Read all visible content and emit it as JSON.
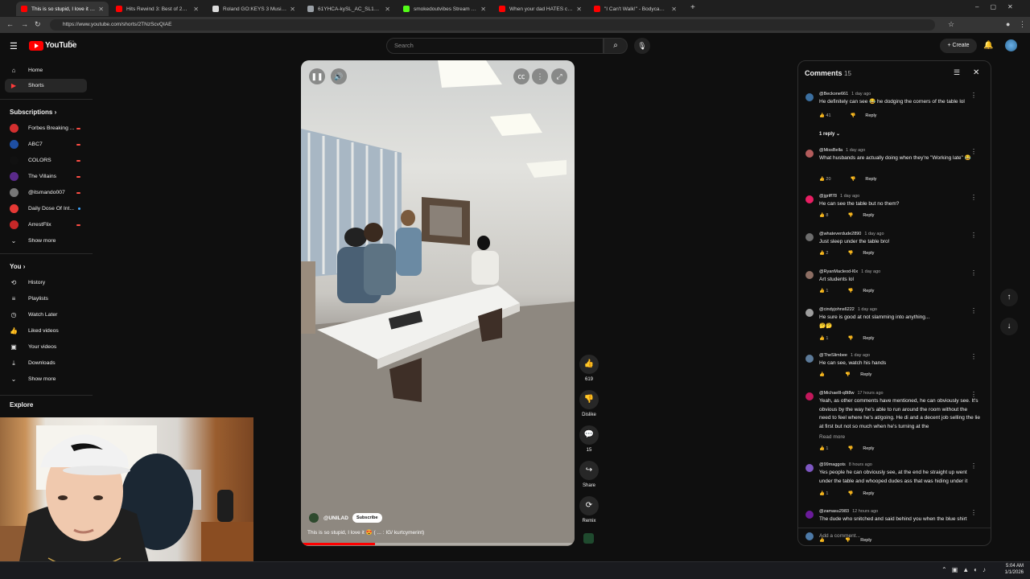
{
  "browser": {
    "tabs": [
      {
        "title": "This is so stupid, I love it 😍 #",
        "favicon_color": "#ff0000",
        "active": true
      },
      {
        "title": "Hits Rewind 3: Best of 2010's H",
        "favicon_color": "#ff0000",
        "active": false
      },
      {
        "title": "Roland GO:KEYS 3 Music Creati",
        "favicon_color": "#dcdcdc",
        "active": false
      },
      {
        "title": "61YHCA-kySL_AC_SL1500_.jpg",
        "favicon_color": "#9aa0a6",
        "active": false
      },
      {
        "title": "smokedoutvibes Stream - Watc",
        "favicon_color": "#53fc18",
        "active": false
      },
      {
        "title": "When your dad HATES cats 😂🐱",
        "favicon_color": "#ff0000",
        "active": false
      },
      {
        "title": "\"I Can't Walk!\" - Bodycam Prov",
        "favicon_color": "#ff0000",
        "active": false
      }
    ],
    "url": "https://www.youtube.com/shorts/2TNzScvQIAE",
    "new_tab": "+"
  },
  "header": {
    "logo_text": "YouTube",
    "country": "CA",
    "search_placeholder": "Search",
    "create_label": "Create"
  },
  "sidebar": {
    "home": "Home",
    "shorts": "Shorts",
    "subscriptions_heading": "Subscriptions",
    "subscriptions": [
      {
        "name": "Forbes Breaking ...",
        "color": "#d32f2f",
        "live": true
      },
      {
        "name": "ABC7",
        "color": "#1e4fa3",
        "live": true
      },
      {
        "name": "COLORS",
        "color": "#111111",
        "live": true
      },
      {
        "name": "The Villains",
        "color": "#5a2a8a",
        "live": true
      },
      {
        "name": "@itsmando007",
        "color": "#777777",
        "live": true
      },
      {
        "name": "Daily Dose Of Int...",
        "color": "#e53935",
        "live": false
      },
      {
        "name": "ArrestFlix",
        "color": "#c62828",
        "live": true
      }
    ],
    "show_more": "Show more",
    "you_heading": "You",
    "you_items": [
      "History",
      "Playlists",
      "Watch Later",
      "Liked videos",
      "Your videos",
      "Downloads",
      "Show more"
    ],
    "explore_heading": "Explore"
  },
  "video": {
    "channel": "@UNILAD",
    "subscribe": "Subscribe",
    "caption": "This is so stupid, I love it 😍 ( ... : IG/ kurtcymerint)",
    "progress": 0.27
  },
  "actions": {
    "likes": "619",
    "dislike": "Dislike",
    "comments": "15",
    "share": "Share",
    "remix": "Remix"
  },
  "comments_panel": {
    "title": "Comments",
    "count": "15",
    "add_placeholder": "Add a comment...",
    "items": [
      {
        "author": "@Beckone661",
        "ago": "1 day ago",
        "text": "He definitely can see 😂 he dodging the corners of the table lol",
        "likes": "41",
        "color": "#3b6fa0",
        "reply": "Reply"
      },
      {
        "author": "@MissBella",
        "ago": "1 day ago",
        "text": "What husbands are actually doing when they're \"Working late\" 😂",
        "likes": "20",
        "color": "#b35c5c",
        "reply": "Reply"
      },
      {
        "author": "@jgriff78",
        "ago": "1 day ago",
        "text": "He can see the table but no them?",
        "likes": "8",
        "color": "#e91e63",
        "reply": "Reply"
      },
      {
        "author": "@whateverdude2890",
        "ago": "1 day ago",
        "text": "Just sleep under the table bro!",
        "likes": "2",
        "color": "#6d6d6d",
        "reply": "Reply"
      },
      {
        "author": "@RyanMacleod-l6x",
        "ago": "1 day ago",
        "text": "Art students lol",
        "likes": "1",
        "color": "#8d6e63",
        "reply": "Reply"
      },
      {
        "author": "@cindyjohns6222",
        "ago": "1 day ago",
        "text": "He sure is good at not slamming into anything...",
        "text2": "🤔🤔",
        "likes": "1",
        "color": "#9e9e9e",
        "reply": "Reply"
      },
      {
        "author": "@TheSlimbee",
        "ago": "1 day ago",
        "text": "He can see, watch his hands",
        "likes": "",
        "color": "#5c7a99",
        "reply": "Reply"
      },
      {
        "author": "@Michaelll-q8t8w",
        "ago": "17 hours ago",
        "text": "Yeah, as other comments have mentioned, he can obviously see. It's obvious by the way he's able to run around the room without the need to feel where he's at/going. He di and a decent job selling the lie at first but not so much when he's turning at the",
        "read_more": "Read more",
        "likes": "1",
        "color": "#c2185b",
        "reply": "Reply"
      },
      {
        "author": "@99maggots",
        "ago": "8 hours ago",
        "text": "Yes people he can obviously see, at the end he straight up went under the table and whooped dudes ass that was hiding under it",
        "likes": "1",
        "color": "#7e57c2",
        "reply": "Reply"
      },
      {
        "author": "@zamasu2983",
        "ago": "12 hours ago",
        "text": "The dude who snitched and said behind you when the blue shirt",
        "likes": "",
        "color": "#6a1b9a",
        "reply": "Reply"
      }
    ],
    "replies_toggle": "1 reply"
  },
  "taskbar": {
    "time": "5:04 AM",
    "date": "1/1/2026"
  }
}
